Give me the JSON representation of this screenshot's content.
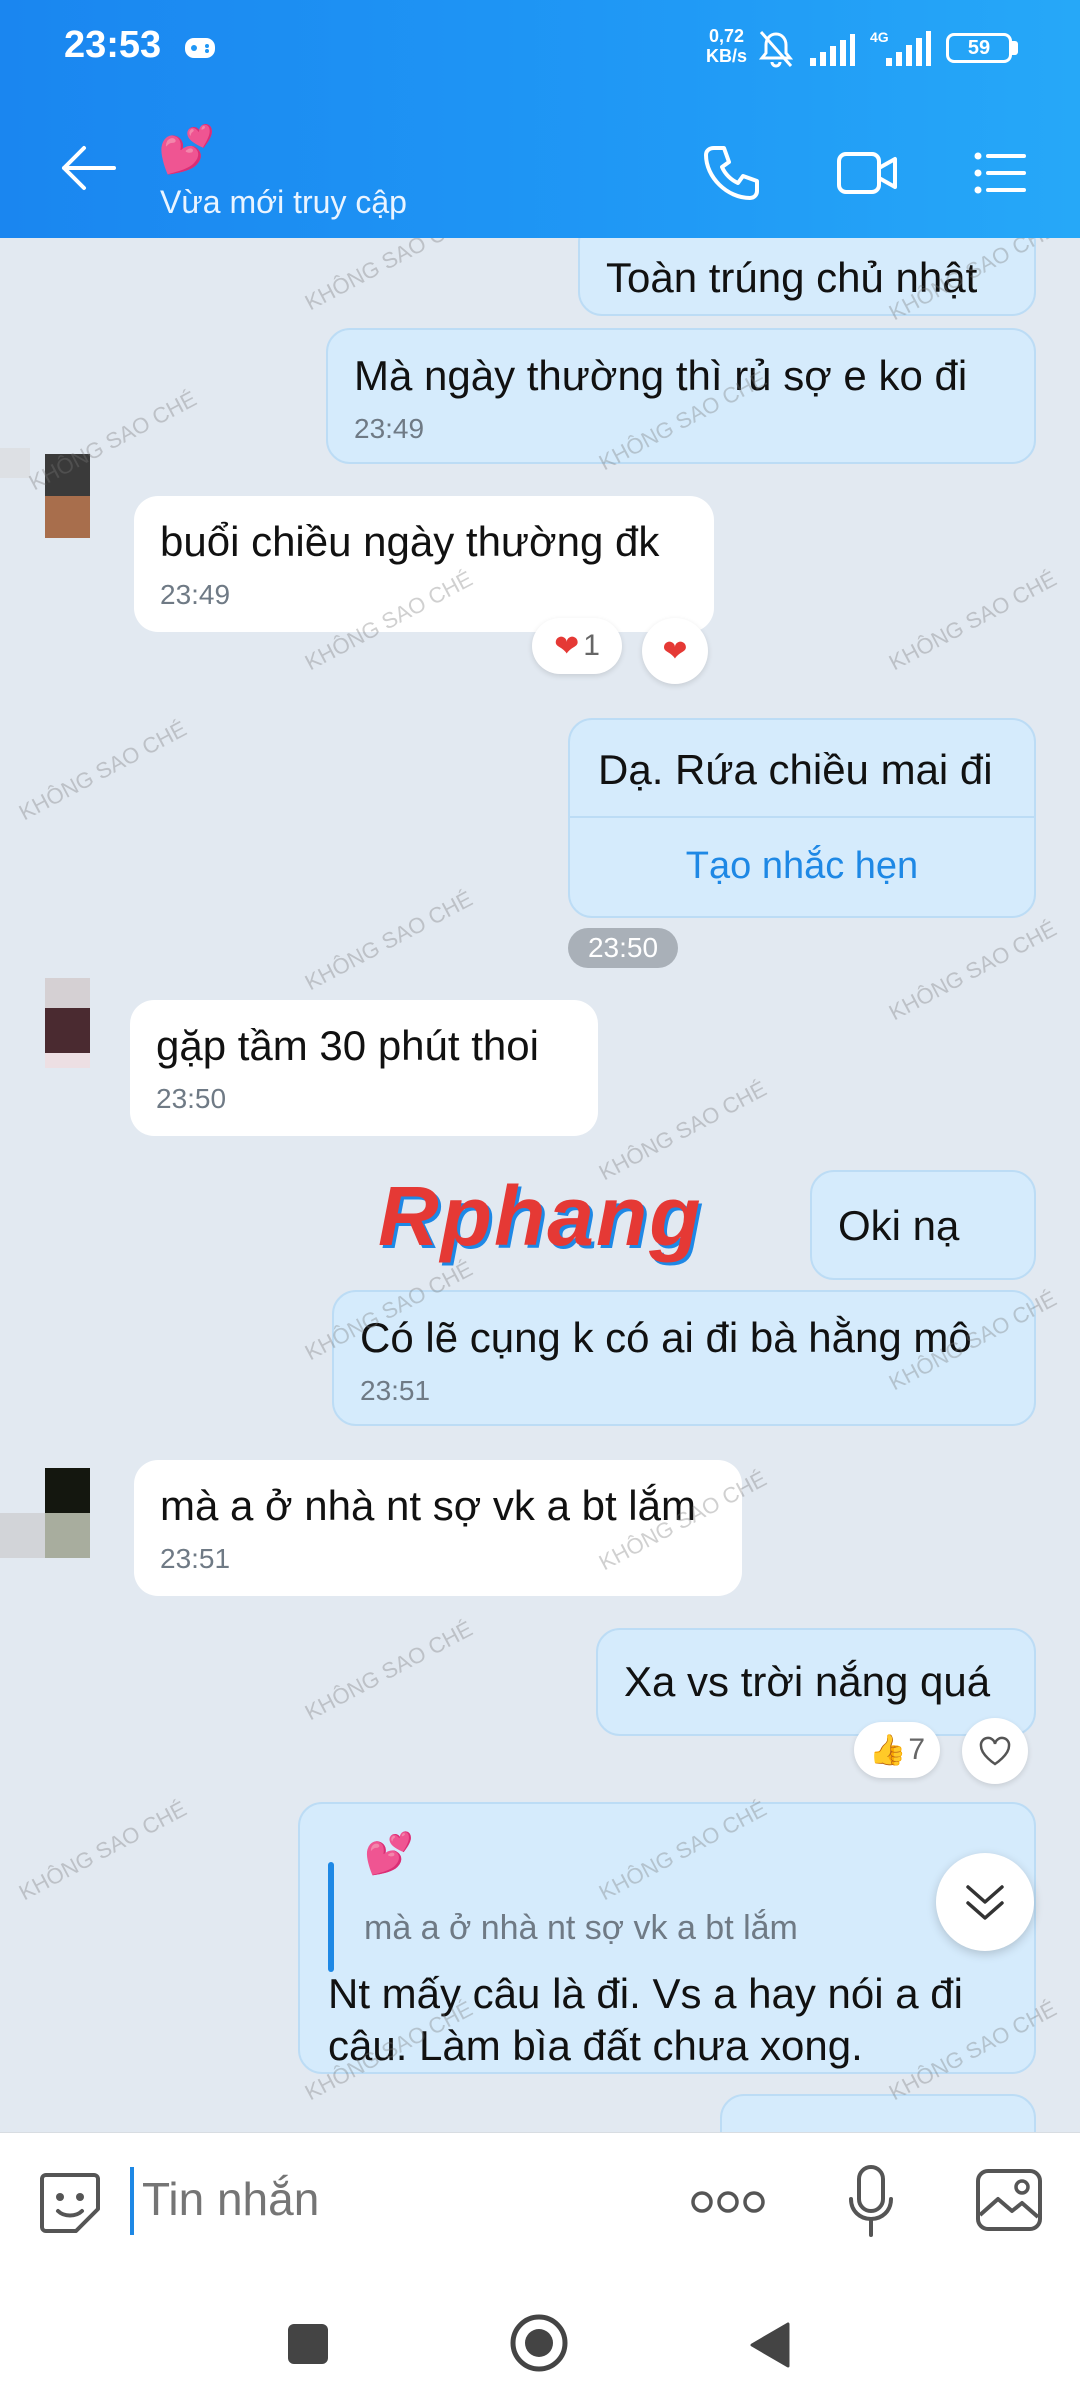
{
  "status_bar": {
    "time": "23:53",
    "net_speed_value": "0,72",
    "net_speed_unit": "KB/s",
    "network_label": "4G",
    "battery": "59"
  },
  "header": {
    "contact_emoji": "💕",
    "contact_status": "Vừa mới truy cập"
  },
  "messages": {
    "m1": {
      "text": "Toàn trúng chủ nhật"
    },
    "m2": {
      "text": "Mà ngày thường thì rủ sợ e ko đi",
      "time": "23:49"
    },
    "m3": {
      "text": "buổi chiều ngày thường đk",
      "time": "23:49",
      "reaction_count": "1"
    },
    "m4": {
      "text": "Dạ. Rứa chiều mai đi",
      "reminder": "Tạo nhắc hẹn"
    },
    "time_chip": "23:50",
    "m5": {
      "text": "gặp tầm 30 phút thoi",
      "time": "23:50"
    },
    "m6": {
      "text": "Oki nạ"
    },
    "m7": {
      "text": "Có lẽ cụng k có ai đi bà hằng mô",
      "time": "23:51"
    },
    "m8": {
      "text": "mà a ở nhà nt sợ vk a bt lắm",
      "time": "23:51"
    },
    "m9": {
      "text": "Xa vs trời nắng quá",
      "reaction_count": "7"
    },
    "m10": {
      "quote_emoji": "💕",
      "quote_text": "mà a ở nhà nt sợ vk a bt lắm",
      "text": "Nt mấy câu là đi. Vs a hay nói a đi câu. Làm bìa đất chưa xong."
    }
  },
  "overlay": {
    "brand": "Rphang",
    "watermark": "KHÔNG SAO CHÉ"
  },
  "composer": {
    "placeholder": "Tin nhắn"
  },
  "colors": {
    "header": "#1f97f5",
    "sent_bubble": "#d5ebfc",
    "received_bubble": "#ffffff",
    "link": "#1e88e5"
  },
  "icons": [
    "back-arrow-icon",
    "phone-icon",
    "video-camera-icon",
    "list-menu-icon",
    "heart-icon",
    "thumbs-up-icon",
    "chevron-down-icon",
    "sticker-icon",
    "more-icon",
    "microphone-icon",
    "gallery-icon"
  ]
}
